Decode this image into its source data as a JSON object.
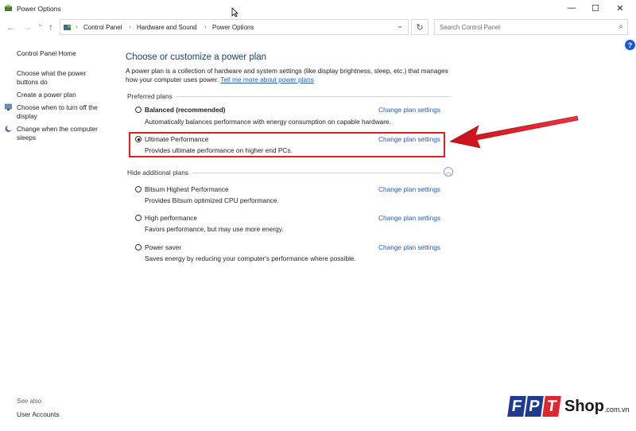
{
  "window": {
    "title": "Power Options",
    "minimize_glyph": "—",
    "maximize_glyph": "☐",
    "close_glyph": "✕"
  },
  "nav": {
    "back_glyph": "←",
    "forward_glyph": "→",
    "recent_glyph": "⌄",
    "up_glyph": "↑",
    "breadcrumb": [
      "Control Panel",
      "Hardware and Sound",
      "Power Options"
    ],
    "dropdown_glyph": "⌄",
    "refresh_glyph": "↻",
    "search_placeholder": "Search Control Panel",
    "search_glyph": "⌕",
    "help_glyph": "?"
  },
  "sidebar": {
    "home": "Control Panel Home",
    "links": [
      {
        "label": "Choose what the power buttons do",
        "icon": ""
      },
      {
        "label": "Create a power plan",
        "icon": ""
      },
      {
        "label": "Choose when to turn off the display",
        "icon": "monitor-icon"
      },
      {
        "label": "Change when the computer sleeps",
        "icon": "moon-icon"
      }
    ],
    "see_also": "See also",
    "user_accounts": "User Accounts"
  },
  "main": {
    "heading": "Choose or customize a power plan",
    "intro": "A power plan is a collection of hardware and system settings (like display brightness, sleep, etc.) that manages how your computer uses power.",
    "intro_link": "Tell me more about power plans",
    "preferred_label": "Preferred plans",
    "additional_label": "Hide additional plans",
    "change_link": "Change plan settings",
    "preferred_plans": [
      {
        "name": "Balanced (recommended)",
        "desc": "Automatically balances performance with energy consumption on capable hardware.",
        "selected": false
      },
      {
        "name": "Ultimate Performance",
        "desc": "Provides ultimate performance on higher end PCs.",
        "selected": true
      }
    ],
    "additional_plans": [
      {
        "name": "Bitsum Highest Performance",
        "desc": "Provides Bitsum optimized CPU performance.",
        "selected": false
      },
      {
        "name": "High performance",
        "desc": "Favors performance, but may use more energy.",
        "selected": false
      },
      {
        "name": "Power saver",
        "desc": "Saves energy by reducing your computer's performance where possible.",
        "selected": false
      }
    ]
  },
  "watermark": {
    "letters": [
      "F",
      "P",
      "T"
    ],
    "shop": "Shop",
    "suffix": ".com.vn",
    "colors": {
      "f": "#1f3b8f",
      "p": "#1f3b8f",
      "t": "#e0262c"
    }
  },
  "colors": {
    "link": "#1f5db5",
    "highlight": "#e02020",
    "heading": "#1e3f66"
  }
}
